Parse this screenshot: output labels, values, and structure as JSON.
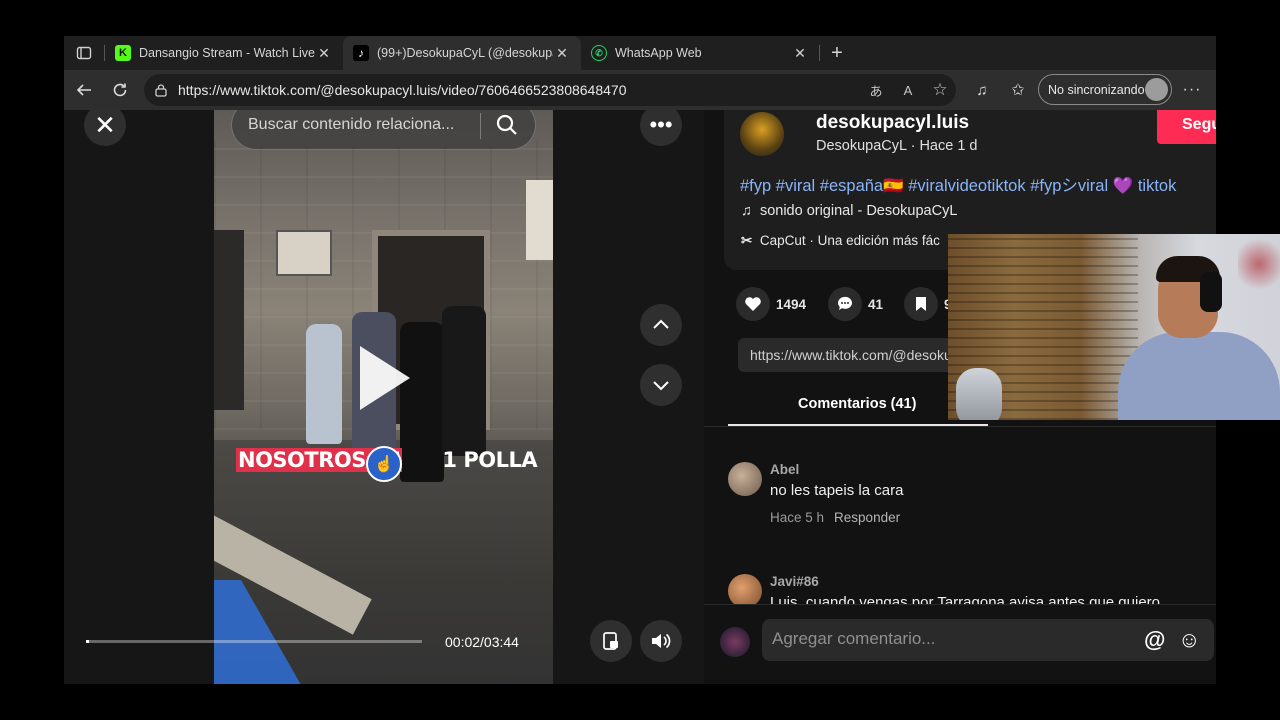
{
  "tabs": [
    {
      "title": "Dansangio Stream - Watch Live o",
      "favicon": "kick-icon",
      "active": false
    },
    {
      "title": "(99+)DesokupaCyL (@desokupa",
      "favicon": "tiktok-icon",
      "active": true
    },
    {
      "title": "WhatsApp Web",
      "favicon": "whatsapp-icon",
      "active": false
    }
  ],
  "toolbar": {
    "url": "https://www.tiktok.com/@desokupacyl.luis/video/7606466523808648470",
    "sync_label": "No sincronizando"
  },
  "video": {
    "search_placeholder": "Buscar contenido relaciona...",
    "caption_highlight": "NOSOTROS MI",
    "caption_rest": "1 POLLA",
    "time": "00:02/03:44",
    "progress": 0.01
  },
  "post": {
    "username": "desokupacyl.luis",
    "nickname": "DesokupaCyL",
    "age": "Hace 1 d",
    "follow_label": "Seguir",
    "hashtags": "#fyp #viral #españa🇪🇸 #viralvideotiktok #fypシviral 💜 tiktok",
    "sound": "sonido original - DesokupaCyL",
    "capcut": "CapCut · Una edición más fác",
    "likes": "1494",
    "comments_count": "41",
    "saves": "9",
    "share_url": "https://www.tiktok.com/@desokupacyl.luis/video/7606466523808648470",
    "comments_tab": "Comentarios (41)"
  },
  "comments": [
    {
      "name": "Abel",
      "text": "no les tapeis la cara",
      "age": "Hace 5 h",
      "reply": "Responder"
    },
    {
      "name": "Javi#86",
      "text": "Luis, cuando vengas por Tarragona avisa antes que quiero",
      "age": "",
      "reply": ""
    }
  ],
  "composer": {
    "placeholder": "Agregar comentario..."
  }
}
